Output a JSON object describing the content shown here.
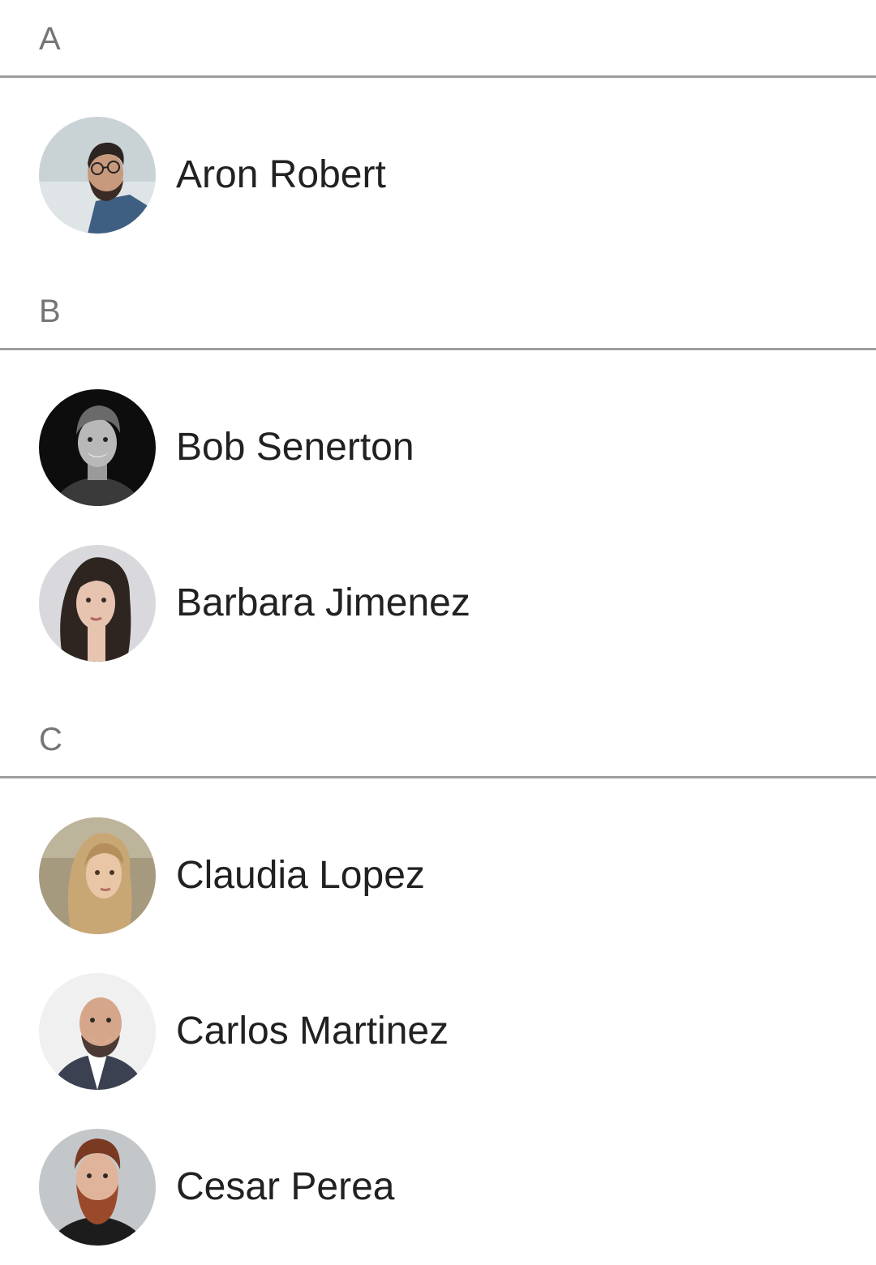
{
  "sections": [
    {
      "letter": "A",
      "contacts": [
        {
          "name": "Aron Robert",
          "avatar_icon": "avatar-photo-man-glasses-beard"
        }
      ]
    },
    {
      "letter": "B",
      "contacts": [
        {
          "name": "Bob Senerton",
          "avatar_icon": "avatar-photo-man-smiling-bw"
        },
        {
          "name": "Barbara Jimenez",
          "avatar_icon": "avatar-photo-woman-dark-hair"
        }
      ]
    },
    {
      "letter": "C",
      "contacts": [
        {
          "name": "Claudia Lopez",
          "avatar_icon": "avatar-photo-woman-blonde"
        },
        {
          "name": "Carlos Martinez",
          "avatar_icon": "avatar-photo-man-bald-suit"
        },
        {
          "name": "Cesar Perea",
          "avatar_icon": "avatar-photo-man-red-beard"
        }
      ]
    }
  ],
  "colors": {
    "header_text": "#757575",
    "name_text": "#212121",
    "divider": "#9e9e9e",
    "background": "#ffffff"
  }
}
